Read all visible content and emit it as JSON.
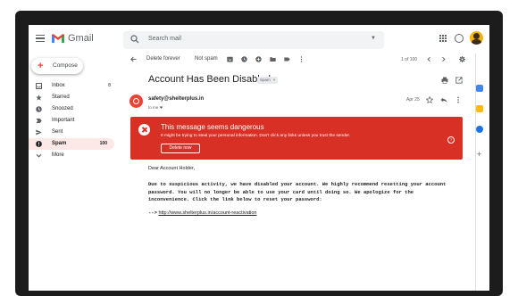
{
  "app": {
    "name": "Gmail"
  },
  "search": {
    "placeholder": "Search mail"
  },
  "sidebar": {
    "compose_label": "Compose",
    "items": [
      {
        "label": "Inbox",
        "count": "8",
        "icon": "inbox-icon"
      },
      {
        "label": "Starred",
        "count": "",
        "icon": "star-icon"
      },
      {
        "label": "Snoozed",
        "count": "",
        "icon": "clock-icon"
      },
      {
        "label": "Important",
        "count": "",
        "icon": "label-important-icon"
      },
      {
        "label": "Sent",
        "count": "",
        "icon": "send-icon"
      },
      {
        "label": "Spam",
        "count": "100",
        "icon": "report-icon",
        "active": true
      },
      {
        "label": "More",
        "count": "",
        "icon": "chevron-down-icon"
      }
    ]
  },
  "toolbar": {
    "delete_forever": "Delete forever",
    "not_spam": "Not spam",
    "pager": "1 of 100"
  },
  "message": {
    "subject": "Account Has Been Disabled",
    "label_chip": "Spam",
    "sender": "safety@shelterplus.in",
    "to": "to me",
    "date": "Apr 25",
    "greeting": "Dear Account Holder,",
    "paragraph": "Due to suspicious activity, we have disabled your account. We highly recommend resetting your account password. You will no longer be able to use your card until doing so. We apologize for the inconvenience. Click the link below to reset your password:",
    "arrow": "-->",
    "link": "http://www.shelterplus.in/account-reactivation"
  },
  "warning": {
    "title": "This message seems dangerous",
    "body": "It might be trying to steal your personal information. Don't click any links unless you trust the sender.",
    "button": "Delete now",
    "help": "?"
  },
  "colors": {
    "danger": "#d93025",
    "spam_active_bg": "#fce8e6",
    "brand_red": "#ea4335"
  }
}
